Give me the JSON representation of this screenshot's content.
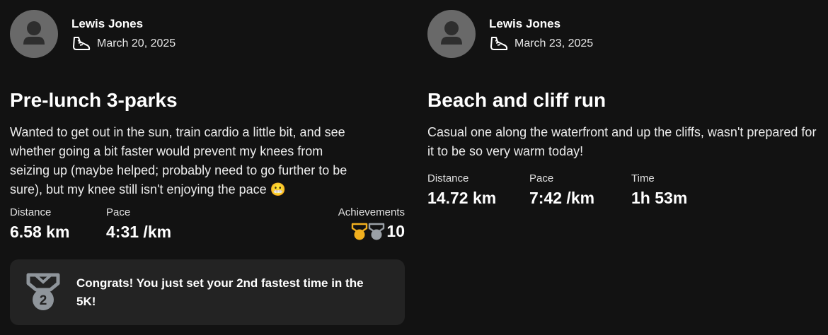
{
  "posts": [
    {
      "author": "Lewis Jones",
      "activity_icon": "running-shoe-icon",
      "date": "March 20, 2025",
      "title": "Pre-lunch 3-parks",
      "description": "Wanted to get out in the sun, train cardio a little bit, and see whether going a bit faster would prevent my knees from seizing up (maybe helped; probably need to go further to be sure), but my knee still isn't enjoying the pace 😬",
      "stats": [
        {
          "label": "Distance",
          "value": "6.58 km"
        },
        {
          "label": "Pace",
          "value": "4:31 /km"
        }
      ],
      "achievements": {
        "label": "Achievements",
        "count": "10",
        "icons": [
          "gold-medal-icon",
          "silver-medal-icon"
        ]
      },
      "banner": {
        "icon": "second-place-medal-icon",
        "text": "Congrats! You just set your 2nd fastest time in the 5K!"
      }
    },
    {
      "author": "Lewis Jones",
      "activity_icon": "running-shoe-icon",
      "date": "March 23, 2025",
      "title": "Beach and cliff run",
      "description": "Casual one along the waterfront and up the cliffs, wasn't prepared for it to be so very warm today!",
      "stats": [
        {
          "label": "Distance",
          "value": "14.72 km"
        },
        {
          "label": "Pace",
          "value": "7:42 /km"
        },
        {
          "label": "Time",
          "value": "1h 53m"
        }
      ]
    }
  ],
  "colors": {
    "background": "#121212",
    "banner": "#232323",
    "avatar": "#696969",
    "gold": "#f2b01e",
    "silver": "#9aa0a6"
  }
}
